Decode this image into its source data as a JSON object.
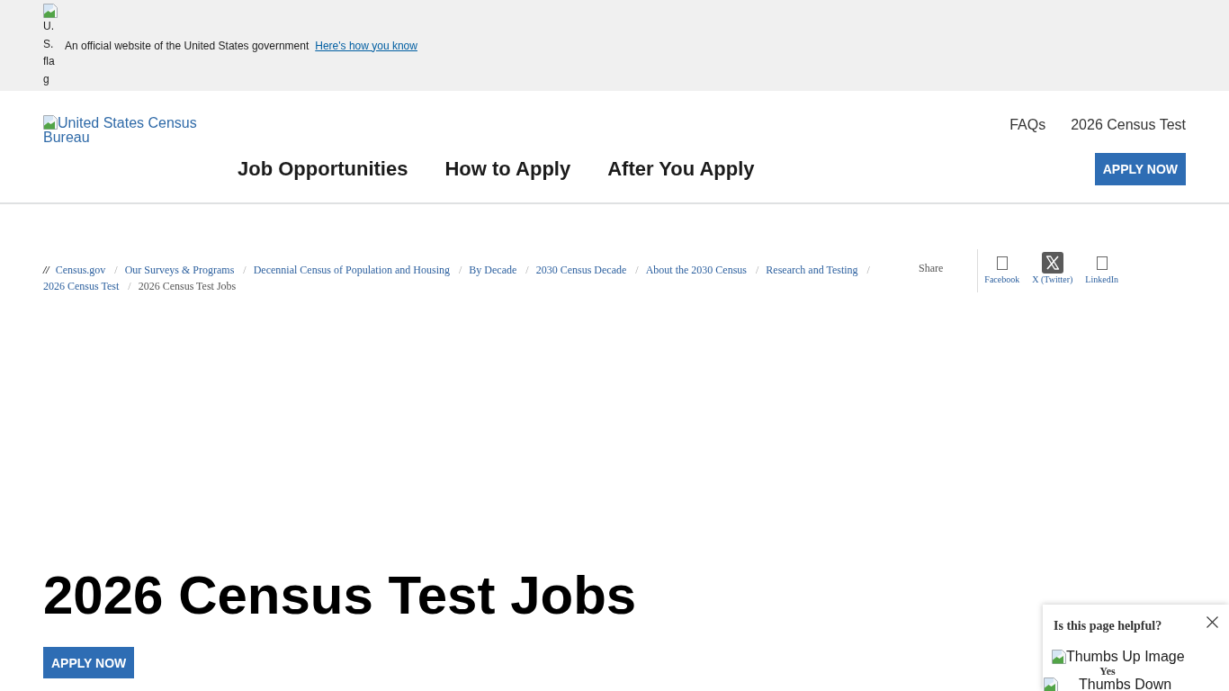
{
  "banner": {
    "flag_alt": "U.S. flag",
    "text": "An official website of the United States government",
    "link": "Here's how you know"
  },
  "header": {
    "logo_alt": "United States Census Bureau",
    "utility_links": [
      "FAQs",
      "2026 Census Test"
    ],
    "nav": [
      "Job Opportunities",
      "How to Apply",
      "After You Apply"
    ],
    "apply_button": "APPLY NOW"
  },
  "breadcrumb": {
    "prefix": "//",
    "items": [
      {
        "label": "Census.gov",
        "current": false,
        "separator": "/"
      },
      {
        "label": "Our Surveys & Programs",
        "current": false,
        "separator": "/"
      },
      {
        "label": "Decennial Census of Population and Housing",
        "current": false,
        "separator": "/"
      },
      {
        "label": "By Decade",
        "current": false,
        "separator": "/"
      },
      {
        "label": "2030 Census Decade",
        "current": false,
        "separator": "/"
      },
      {
        "label": "About the 2030 Census",
        "current": false,
        "separator": "/"
      },
      {
        "label": "Research and Testing",
        "current": false,
        "separator": "/"
      },
      {
        "label": "2026 Census Test",
        "current": false,
        "separator": "/"
      },
      {
        "label": "2026 Census Test Jobs",
        "current": true
      }
    ]
  },
  "share": {
    "label": "Share",
    "links": [
      {
        "label": "Facebook",
        "kind": "outline"
      },
      {
        "label": "X (Twitter)",
        "kind": "x-logo"
      },
      {
        "label": "LinkedIn",
        "kind": "outline"
      }
    ]
  },
  "page": {
    "title": "2026 Census Test Jobs",
    "apply_button": "APPLY NOW"
  },
  "feedback": {
    "question": "Is this page helpful?",
    "yes_alt": "Thumbs Up Image",
    "yes_label": "Yes",
    "no_alt": "Thumbs Down"
  }
}
